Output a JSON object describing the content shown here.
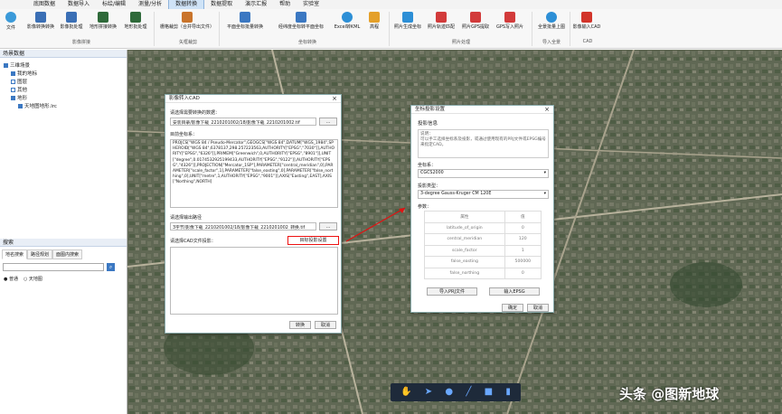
{
  "menu": {
    "items": [
      "底图数据",
      "数据导入",
      "标绘/编辑",
      "测量/分析",
      "数据转换",
      "数据提取",
      "演示汇报",
      "帮助",
      "实验室"
    ],
    "active_index": 4
  },
  "ribbon": {
    "file_label": "文件",
    "buttons": [
      {
        "label": "影像转换转换",
        "icon": "image-convert-icon",
        "color": "#3a6fb5"
      },
      {
        "label": "影像批处理",
        "icon": "image-batch-icon",
        "color": "#3a6fb5"
      },
      {
        "label": "地形拼接转换",
        "icon": "terrain-convert-icon",
        "color": "#2f6a3a"
      },
      {
        "label": "地形批处理",
        "icon": "terrain-batch-icon",
        "color": "#2f6a3a"
      },
      {
        "label": "栅格裁剪（合并导出文件）",
        "icon": "raster-clip-icon",
        "color": "#c9742b"
      },
      {
        "label": "平面坐标批量转换",
        "icon": "coord-batch-icon",
        "color": "#3b78c2"
      },
      {
        "label": "经纬度坐标转平面坐标",
        "icon": "lonlat-convert-icon",
        "color": "#3b78c2"
      },
      {
        "label": "Excel转KML",
        "icon": "excel-kml-icon",
        "color": "#2d8fd6"
      },
      {
        "label": "高程",
        "icon": "elevation-icon",
        "color": "#e4a02a"
      },
      {
        "label": "照片生成坐标",
        "icon": "photo-coord-icon",
        "color": "#2d8fd6"
      },
      {
        "label": "照片轨迹匹配",
        "icon": "photo-track-icon",
        "color": "#d23b3b"
      },
      {
        "label": "照片GPS提取",
        "icon": "photo-gps-icon",
        "color": "#d23b3b"
      },
      {
        "label": "GPS写入照片",
        "icon": "gps-write-icon",
        "color": "#d23b3b"
      },
      {
        "label": "全景批量上图",
        "icon": "panorama-icon",
        "color": "#2d8fd6"
      },
      {
        "label": "影像输入CAD",
        "icon": "cad-import-icon",
        "color": "#d2352b"
      }
    ],
    "groups": [
      "影像拼接",
      "矢框裁剪",
      "坐标转换",
      "照片处理",
      "导入全景",
      "CAD"
    ]
  },
  "left_panel": {
    "title": "场景数据",
    "tree": [
      {
        "label": "三维场景",
        "checked": true
      },
      {
        "label": "我的地标",
        "checked": true
      },
      {
        "label": "图层",
        "checked": false
      },
      {
        "label": "其他",
        "checked": false
      },
      {
        "label": "地形",
        "checked": true
      },
      {
        "label": "天地图地形.lrc",
        "checked": true
      }
    ],
    "search_title": "搜索",
    "tabs": [
      "地名搜索",
      "路径规划",
      "面图内搜索"
    ],
    "radios": [
      "普通",
      "天地图"
    ]
  },
  "dialog_cad": {
    "title": "影像转入CAD",
    "close": "×",
    "input_label": "请选择需要转换的数据：",
    "input_path": "安装目录/影像下载_2210201002/18/影像下载_2210201002.tif",
    "browse": "...",
    "coord_label": "目前坐标系：",
    "coord_text": "PROJCS[\"WGS 84 / Pseudo-Mercator\",GEOGCS[\"WGS 84\",DATUM[\"WGS_1984\",SPHEROID[\"WGS 84\",6378137,298.257223563,AUTHORITY[\"EPSG\",\"7030\"]],AUTHORITY[\"EPSG\",\"6326\"]],PRIMEM[\"Greenwich\",0,AUTHORITY[\"EPSG\",\"8901\"]],UNIT[\"degree\",0.0174532925199433,AUTHORITY[\"EPSG\",\"9122\"]],AUTHORITY[\"EPSG\",\"4326\"]],PROJECTION[\"Mercator_1SP\"],PARAMETER[\"central_meridian\",0],PARAMETER[\"scale_factor\",1],PARAMETER[\"false_easting\",0],PARAMETER[\"false_northing\",0],UNIT[\"metre\",1,AUTHORITY[\"EPSG\",\"9001\"]],AXIS[\"Easting\",EAST],AXIS[\"Northing\",NORTH]",
    "output_label": "请选择输出路径",
    "output_path": "3字节/影像下载_2210201002/18/影像下载_2210201002_转换.tif",
    "browse2": "...",
    "cad_label": "请选择CAD文件投影：",
    "target_button": "目标投影设置",
    "ok": "转换",
    "cancel": "取消"
  },
  "dialog_proj": {
    "title": "坐标投影设置",
    "close": "×",
    "section": "投影信息",
    "desc_label": "说明：",
    "desc_text": "可以手工选择坐标系及投影，或通过使用现有的PRJ文件或EPSG编号来指定CAD。",
    "crs_label": "坐标系：",
    "crs_value": "CGCS2000",
    "proj_label": "投影类型：",
    "proj_value": "3-degree Gauss-Kruger CM 120E",
    "params_label": "参数：",
    "params_headers": [
      "属性",
      "值"
    ],
    "params": [
      {
        "name": "latitude_of_origin",
        "value": "0"
      },
      {
        "name": "central_meridian",
        "value": "120"
      },
      {
        "name": "scale_factor",
        "value": "1"
      },
      {
        "name": "false_easting",
        "value": "500000"
      },
      {
        "name": "false_northing",
        "value": "0"
      }
    ],
    "import_prj": "导入PRJ文件",
    "input_epsg": "输入EPSG",
    "ok": "确定",
    "cancel": "取消"
  },
  "toolbar": {
    "icons": [
      "hand-icon",
      "pointer-icon",
      "pin-icon",
      "line-icon",
      "polygon-icon",
      "chart-icon"
    ]
  },
  "watermark": "头条 @图新地球",
  "colors": {
    "accent": "#3b78c2",
    "highlight": "#e11111",
    "map_dark": "#5f6a55"
  }
}
